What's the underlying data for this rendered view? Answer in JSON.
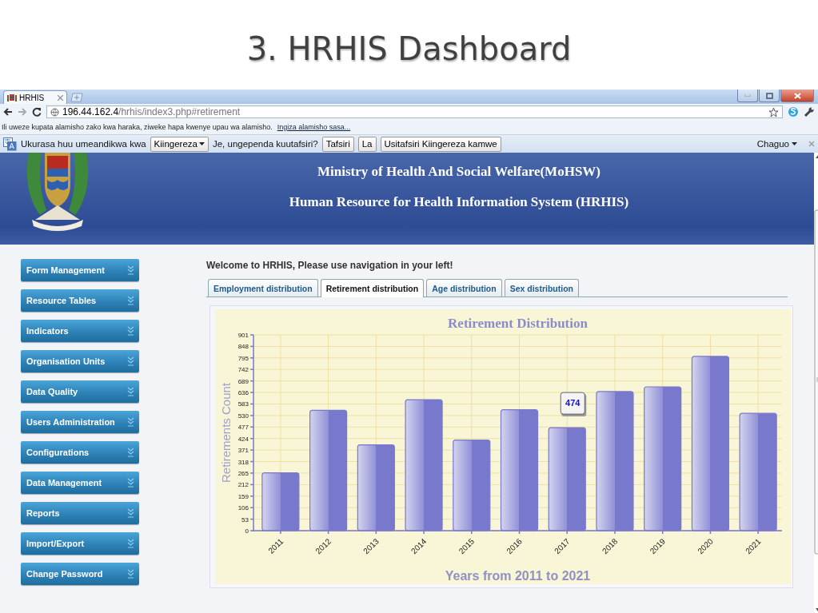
{
  "slide": {
    "title": "3. HRHIS Dashboard"
  },
  "browser": {
    "tab": {
      "title": "HRHIS"
    },
    "address": {
      "host": "196.44.162.4",
      "path": "/hrhis/index3.php#retirement"
    },
    "bookmark_bar": {
      "message": "Ili uweze kupata alamisho zako kwa haraka, ziweke hapa kwenye upau wa alamisho.",
      "link": "Ingiza alamisho sasa..."
    },
    "translate_bar": {
      "text": "Ukurasa huu umeandikwa kwa",
      "language": "Kiingereza",
      "question": "Je, ungependa kuutafsiri?",
      "buttons": [
        "Tafsiri",
        "La",
        "Usitafsiri Kiingereza kamwe"
      ],
      "options": "Chaguo"
    }
  },
  "header": {
    "title": "Ministry of Health And Social Welfare(MoHSW)",
    "subtitle": "Human Resource for Health Information System (HRHIS)"
  },
  "sidebar": {
    "items": [
      "Form Management",
      "Resource Tables",
      "Indicators",
      "Organisation Units",
      "Data Quality",
      "Users Administration",
      "Configurations",
      "Data Management",
      "Reports",
      "Import/Export",
      "Change Password"
    ]
  },
  "welcome": "Welcome to HRHIS, Please use navigation in your left!",
  "tabs": [
    {
      "label": "Employment distribution",
      "selected": false
    },
    {
      "label": "Retirement distribution",
      "selected": true
    },
    {
      "label": "Age distribution",
      "selected": false
    },
    {
      "label": "Sex distribution",
      "selected": false
    }
  ],
  "chart": {
    "tooltip": {
      "text": "474"
    },
    "chart_data": {
      "type": "bar",
      "title": "Retirement Distribution",
      "xlabel": "Years from 2011 to 2021",
      "ylabel": "Retirements Count",
      "categories": [
        "2011",
        "2012",
        "2013",
        "2014",
        "2015",
        "2016",
        "2017",
        "2018",
        "2019",
        "2020",
        "2021"
      ],
      "grid": true,
      "series": [
        {
          "color": "#7878cc",
          "values": [
            266,
            554,
            395,
            603,
            417,
            557,
            474,
            640,
            662,
            802,
            540
          ]
        }
      ],
      "ylim": [
        0,
        901
      ],
      "yticks": [
        0,
        53,
        106,
        159,
        212,
        265,
        318,
        371,
        424,
        477,
        530,
        583,
        636,
        689,
        742,
        795,
        848,
        901
      ]
    }
  }
}
